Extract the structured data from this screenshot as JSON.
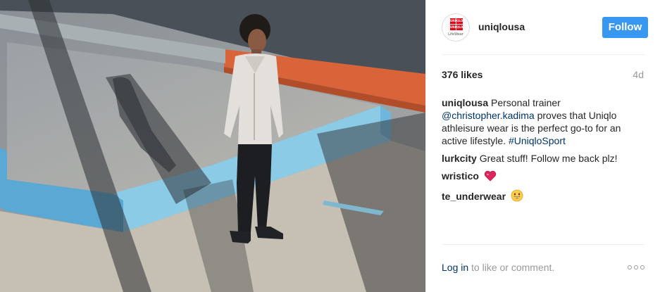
{
  "post": {
    "image_alt": "Man in light grey hoodie and black joggers standing on concrete with long shadows",
    "author": {
      "username": "uniqlousa",
      "avatar_logo": [
        "UNI",
        "QLO",
        "UNI",
        "QLO"
      ],
      "avatar_subtitle": "LifeWear"
    },
    "follow_label": "Follow",
    "likes": "376 likes",
    "age": "4d",
    "comments": [
      {
        "author": "uniqlousa",
        "text_before": "Personal trainer",
        "mention": "@christopher.kadima",
        "text_middle": "proves that Uniqlo athleisure wear is the perfect go-to for an active lifestyle.",
        "hashtag": "#UniqloSport"
      },
      {
        "author": "lurkcity",
        "text": "Great stuff! Follow me back plz!"
      },
      {
        "author": "wristico",
        "emoji": "red-heart-icon"
      },
      {
        "author": "te_underwear",
        "emoji": "grinning-face-icon"
      }
    ],
    "footer": {
      "login_label": "Log in",
      "login_suffix": "to like or comment."
    },
    "more_options_icon": "ellipsis-icon"
  },
  "colors": {
    "follow_button": "#3897f0",
    "link": "#003569",
    "muted": "#999999",
    "brand_red": "#e60012"
  }
}
